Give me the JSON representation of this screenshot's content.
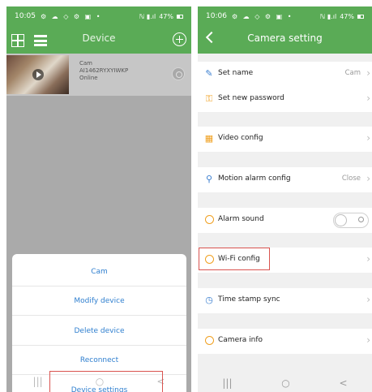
{
  "left": {
    "status": {
      "time": "10:05",
      "icons": "⚙ ☁ ◇ ⚙ ▣ •",
      "signal": "ℕ ▮.ıl",
      "battery": "47%"
    },
    "header": {
      "title": "Device"
    },
    "device": {
      "name": "Cam",
      "id": "AI1462RYXYIWKP",
      "status": "Online"
    },
    "sheet": {
      "items": [
        "Cam",
        "Modify device",
        "Delete device",
        "Reconnect",
        "Device settings"
      ]
    },
    "nav": {
      "recent": "|||",
      "home": "○",
      "back": "<"
    }
  },
  "right": {
    "status": {
      "time": "10:06",
      "icons": "⚙ ☁ ◇ ⚙ ▣ •",
      "signal": "ℕ ▮.ıl",
      "battery": "47%"
    },
    "header": {
      "title": "Camera setting"
    },
    "rows": [
      {
        "label": "Set name",
        "value": "Cam"
      },
      {
        "label": "Set new password",
        "value": ""
      },
      {
        "label": "Video config",
        "value": ""
      },
      {
        "label": "Motion alarm config",
        "value": "Close"
      },
      {
        "label": "Alarm sound",
        "value": ""
      },
      {
        "label": "Wi-Fi config",
        "value": ""
      },
      {
        "label": "Time stamp sync",
        "value": ""
      },
      {
        "label": "Camera info",
        "value": ""
      }
    ],
    "nav": {
      "recent": "|||",
      "home": "○",
      "back": "<"
    }
  },
  "colors": {
    "accent_green": "#5aab56",
    "link_blue": "#2f7fcf",
    "highlight_red": "#d9534f"
  }
}
